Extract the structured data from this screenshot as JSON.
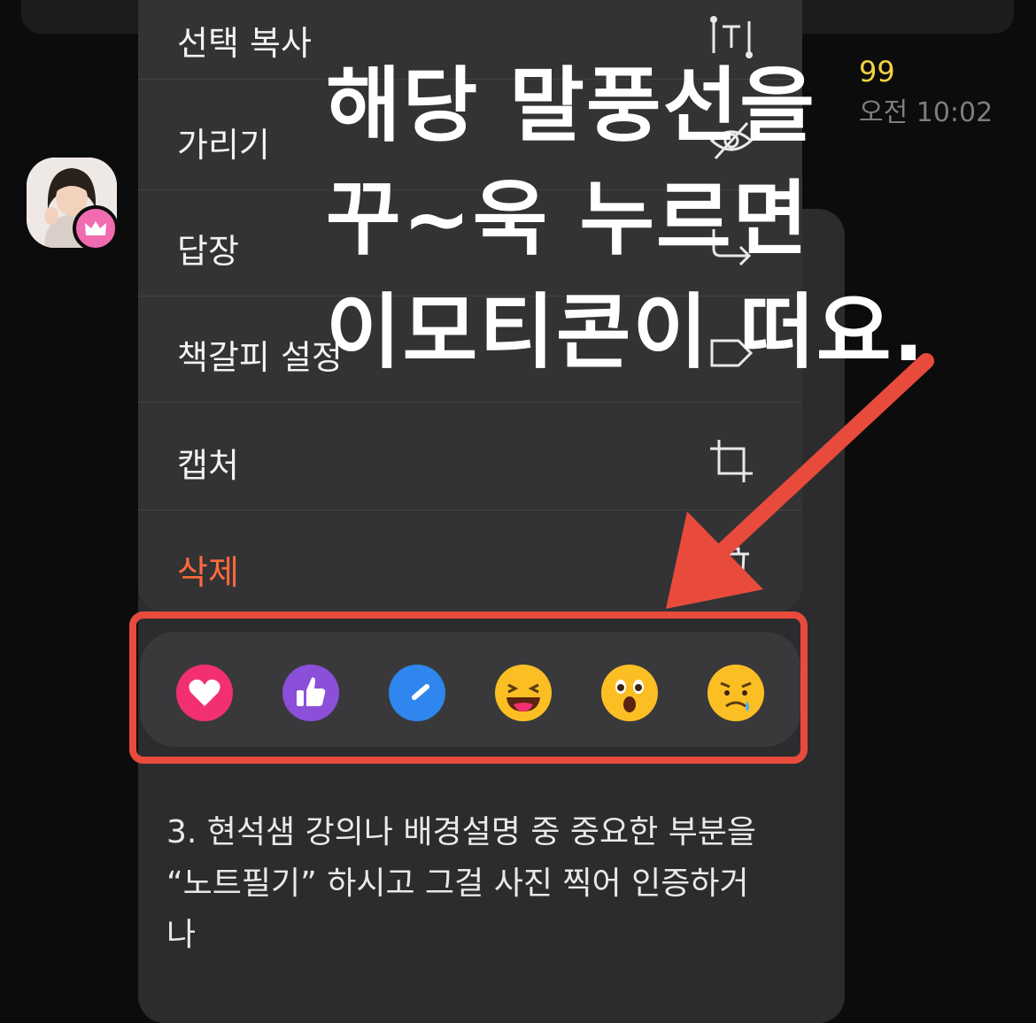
{
  "chat": {
    "unread_count": "99",
    "timestamp": "오전 10:02",
    "message_body": "3. 현석샘 강의나 배경설명 중 중요한 부분을\n“노트필기” 하시고 그걸 사진 찍어 인증하거\n나"
  },
  "context_menu": {
    "items": [
      {
        "label": "선택 복사",
        "icon": "text-cursor-icon"
      },
      {
        "label": "가리기",
        "icon": "eye-slash-icon"
      },
      {
        "label": "답장",
        "icon": "reply-arrow-icon"
      },
      {
        "label": "책갈피 설정",
        "icon": "tag-icon"
      },
      {
        "label": "캡처",
        "icon": "crop-icon"
      },
      {
        "label": "삭제",
        "icon": "trash-icon"
      }
    ]
  },
  "reactions": [
    {
      "name": "heart",
      "color": "#f2306f"
    },
    {
      "name": "thumbs-up",
      "color": "#8b4fd9"
    },
    {
      "name": "check",
      "color": "#2f86ee"
    },
    {
      "name": "laugh",
      "color": "#fbbf24"
    },
    {
      "name": "surprised",
      "color": "#fbbf24"
    },
    {
      "name": "sad",
      "color": "#fbbf24"
    }
  ],
  "annotation": {
    "line1": "해당 말풍선을",
    "line2": "꾸~욱 누르면",
    "line3": "이모티콘이 떠요.",
    "highlight_color": "#e84b3c"
  }
}
